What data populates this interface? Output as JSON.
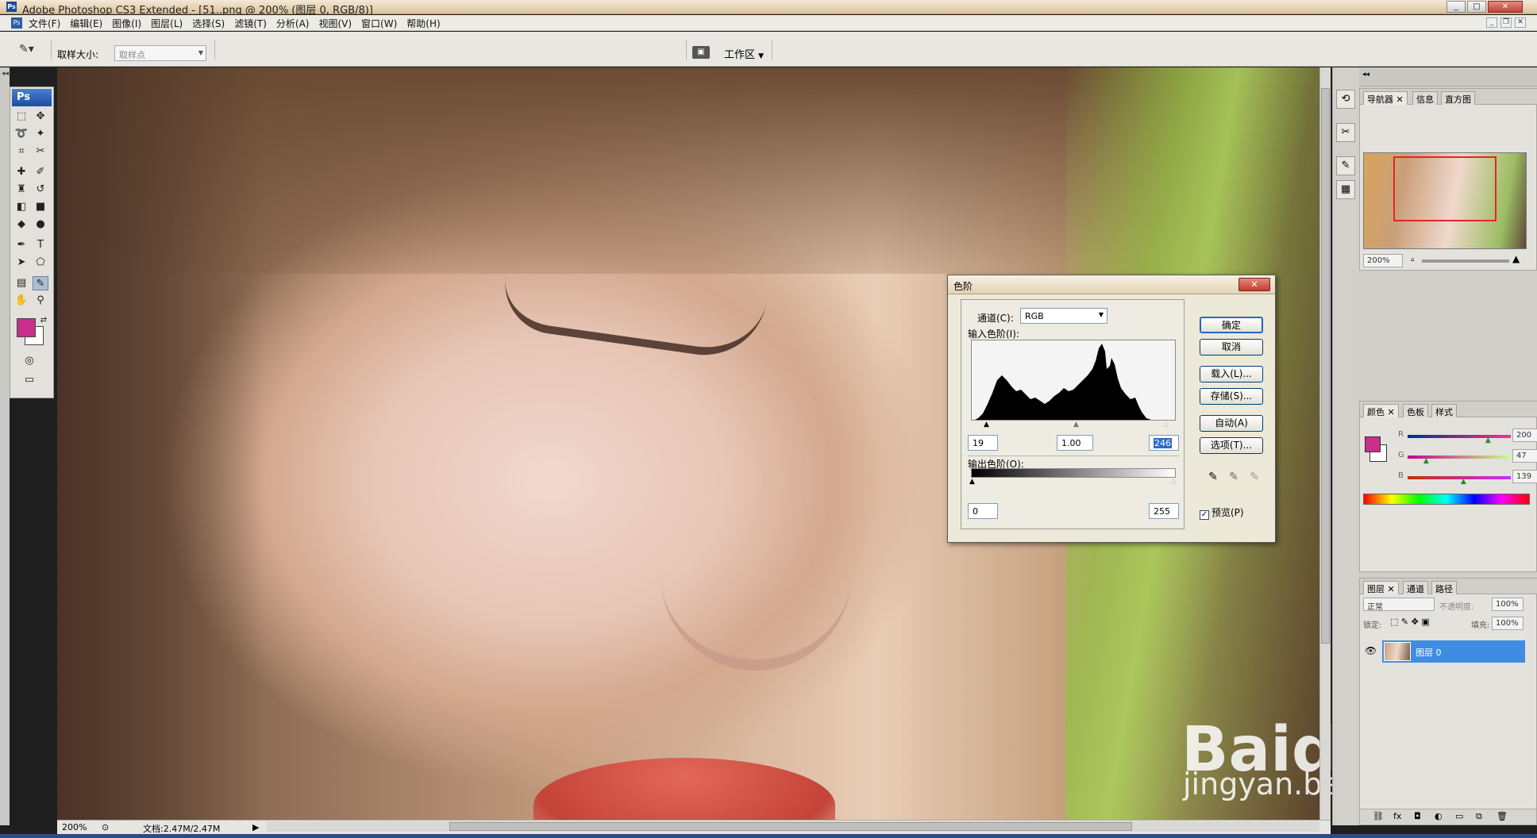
{
  "window": {
    "title": "Adobe Photoshop CS3 Extended - [51..png @ 200% (图层 0, RGB/8)]",
    "minimize": "_",
    "maximize": "□",
    "close": "✕"
  },
  "menubar": {
    "items": [
      "文件(F)",
      "编辑(E)",
      "图像(I)",
      "图层(L)",
      "选择(S)",
      "滤镜(T)",
      "分析(A)",
      "视图(V)",
      "窗口(W)",
      "帮助(H)"
    ]
  },
  "options": {
    "sample_label": "取样大小:",
    "sample_value": "取样点",
    "workspace": "工作区"
  },
  "toolbox": {
    "logo": "Ps"
  },
  "canvas": {
    "watermark_logo": "Baidu经验",
    "watermark_url": "jingyan.baidu.com"
  },
  "status": {
    "zoom": "200%",
    "doc": "文档:2.47M/2.47M"
  },
  "panels": {
    "navigator": {
      "tabs": [
        "导航器",
        "信息",
        "直方图"
      ],
      "zoom": "200%"
    },
    "color": {
      "tabs": [
        "颜色",
        "色板",
        "样式"
      ],
      "r_label": "R",
      "g_label": "G",
      "b_label": "B",
      "r": "200",
      "g": "47",
      "b": "139",
      "r_level": 0.784,
      "g_level": 0.184,
      "b_level": 0.545,
      "fg": "#c82f8b",
      "bg": "#ffffff"
    },
    "layers": {
      "tabs": [
        "图层",
        "通道",
        "路径"
      ],
      "blend_mode": "正常",
      "opacity_label": "不透明度:",
      "opacity": "100%",
      "lock_label": "锁定:",
      "fill_label": "填充:",
      "fill": "100%",
      "layer_name": "图层 0"
    }
  },
  "levels_dialog": {
    "title": "色阶",
    "channel_label": "通道(C):",
    "channel_value": "RGB",
    "input_label": "输入色阶(I):",
    "input_black": "19",
    "input_gamma": "1.00",
    "input_white": "246",
    "output_label": "输出色阶(O):",
    "output_black": "0",
    "output_white": "255",
    "buttons": {
      "ok": "确定",
      "cancel": "取消",
      "load": "载入(L)...",
      "save": "存储(S)...",
      "auto": "自动(A)",
      "options": "选项(T)..."
    },
    "preview_label": "预览(P)",
    "preview_checked": true
  }
}
